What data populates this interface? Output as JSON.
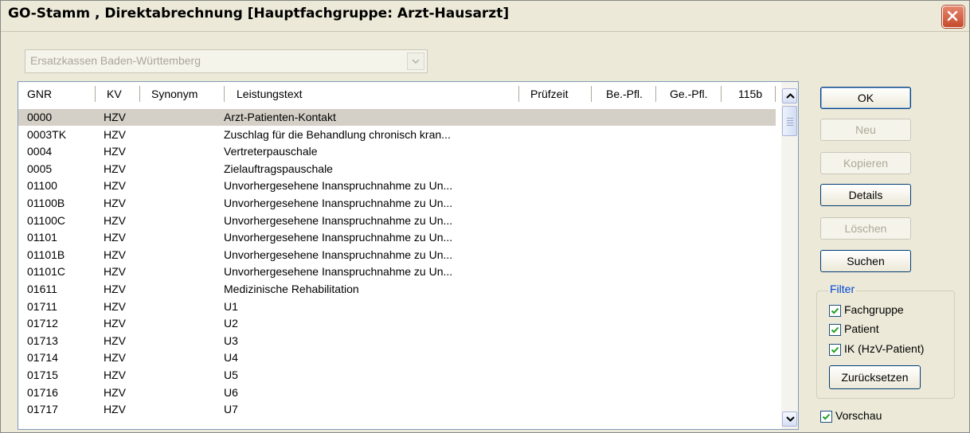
{
  "window": {
    "title": "GO-Stamm , Direktabrechnung [Hauptfachgruppe: Arzt-Hausarzt]"
  },
  "kassen_select": {
    "value": "Ersatzkassen Baden-Württemberg"
  },
  "table": {
    "columns": [
      "GNR",
      "KV",
      "Synonym",
      "Leistungstext",
      "Prüfzeit",
      "Be.-Pfl.",
      "Ge.-Pfl.",
      "115b"
    ],
    "rows": [
      {
        "gnr": "0000",
        "kv": "HZV",
        "text": "Arzt-Patienten-Kontakt"
      },
      {
        "gnr": "0003TK",
        "kv": "HZV",
        "text": "Zuschlag für die Behandlung chronisch kran..."
      },
      {
        "gnr": "0004",
        "kv": "HZV",
        "text": "Vertreterpauschale"
      },
      {
        "gnr": "0005",
        "kv": "HZV",
        "text": "Zielauftragspauschale"
      },
      {
        "gnr": "01100",
        "kv": "HZV",
        "text": "Unvorhergesehene Inanspruchnahme zu Un..."
      },
      {
        "gnr": "01100B",
        "kv": "HZV",
        "text": "Unvorhergesehene Inanspruchnahme zu Un..."
      },
      {
        "gnr": "01100C",
        "kv": "HZV",
        "text": "Unvorhergesehene Inanspruchnahme zu Un..."
      },
      {
        "gnr": "01101",
        "kv": "HZV",
        "text": "Unvorhergesehene Inanspruchnahme zu Un..."
      },
      {
        "gnr": "01101B",
        "kv": "HZV",
        "text": "Unvorhergesehene Inanspruchnahme zu Un..."
      },
      {
        "gnr": "01101C",
        "kv": "HZV",
        "text": "Unvorhergesehene Inanspruchnahme zu Un..."
      },
      {
        "gnr": "01611",
        "kv": "HZV",
        "text": "Medizinische Rehabilitation"
      },
      {
        "gnr": "01711",
        "kv": "HZV",
        "text": "U1"
      },
      {
        "gnr": "01712",
        "kv": "HZV",
        "text": "U2"
      },
      {
        "gnr": "01713",
        "kv": "HZV",
        "text": "U3"
      },
      {
        "gnr": "01714",
        "kv": "HZV",
        "text": "U4"
      },
      {
        "gnr": "01715",
        "kv": "HZV",
        "text": "U5"
      },
      {
        "gnr": "01716",
        "kv": "HZV",
        "text": "U6"
      },
      {
        "gnr": "01717",
        "kv": "HZV",
        "text": "U7"
      }
    ]
  },
  "buttons": {
    "ok": "OK",
    "neu": "Neu",
    "kopieren": "Kopieren",
    "details": "Details",
    "loeschen": "Löschen",
    "suchen": "Suchen",
    "reset": "Zurücksetzen"
  },
  "filter": {
    "legend": "Filter",
    "fachgruppe": "Fachgruppe",
    "patient": "Patient",
    "ik": "IK (HzV-Patient)"
  },
  "vorschau": "Vorschau",
  "icons": {
    "close": "close-icon",
    "dropdown": "chevron-down-icon",
    "scroll_up": "arrow-up-icon",
    "scroll_down": "arrow-down-icon",
    "check": "check-icon"
  },
  "colors": {
    "close_red": "#c64a2b",
    "filter_legend": "#0046d5",
    "selected_row": "#d4d0c8"
  }
}
